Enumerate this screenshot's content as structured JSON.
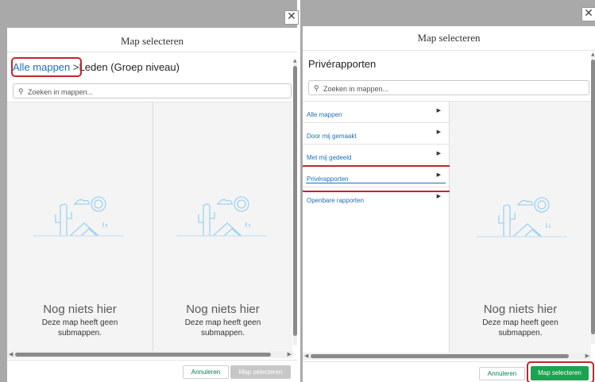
{
  "left_modal": {
    "title": "Map selecteren",
    "breadcrumb_root": "Alle mappen",
    "breadcrumb_sep": ">",
    "breadcrumb_current": "Leden (Groep niveau)",
    "search_placeholder": "Zoeken in mappen...",
    "panels": [
      {
        "empty_title": "Nog niets hier",
        "empty_line1": "Deze map heeft geen",
        "empty_line2": "submappen."
      },
      {
        "empty_title": "Nog niets hier",
        "empty_line1": "Deze map heeft geen",
        "empty_line2": "submappen."
      }
    ],
    "cancel_label": "Annuleren",
    "select_label": "Map selecteren"
  },
  "right_modal": {
    "title": "Map selecteren",
    "heading": "Privérapporten",
    "search_placeholder": "Zoeken in mappen...",
    "folders": [
      {
        "label": "Alle mappen"
      },
      {
        "label": "Door mij gemaakt"
      },
      {
        "label": "Met mij gedeeld"
      },
      {
        "label": "Privérapporten",
        "selected": true
      },
      {
        "label": "Openbare rapporten"
      }
    ],
    "empty_title": "Nog niets hier",
    "empty_line1": "Deze map heeft geen",
    "empty_line2": "submappen.",
    "cancel_label": "Annuleren",
    "select_label": "Map selecteren"
  },
  "icons": {
    "close": "close-icon",
    "search": "search-icon",
    "chevron": "chevron-right-icon",
    "empty": "cactus-desert-illustration"
  },
  "colors": {
    "accent_link": "#1f6fb8",
    "primary_button": "#1aa350",
    "annotation_ring": "#c0262d",
    "illustration": "#9fd3f0"
  }
}
